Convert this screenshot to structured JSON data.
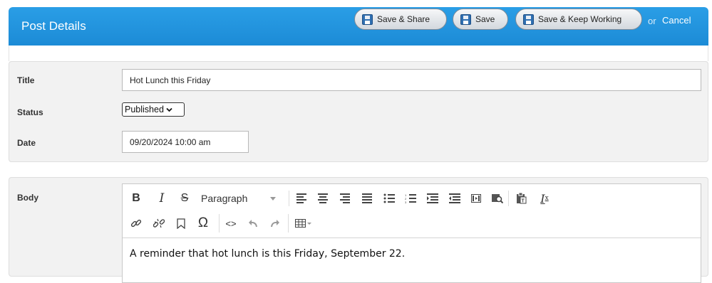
{
  "header": {
    "title": "Post Details",
    "save_share_label": "Save & Share",
    "save_label": "Save",
    "save_keep_label": "Save & Keep Working",
    "or_text": "or",
    "cancel_label": "Cancel",
    "accent_color": "#1f93dd"
  },
  "fields": {
    "title_label": "Title",
    "title_value": "Hot Lunch this Friday",
    "status_label": "Status",
    "status_value": "Published",
    "date_label": "Date",
    "date_value": "09/20/2024 10:00 am",
    "body_label": "Body"
  },
  "editor": {
    "format_select": "Paragraph",
    "toolbar_row1": [
      "bold-icon",
      "italic-icon",
      "strikethrough-icon",
      "format-select",
      "align-left-icon",
      "align-center-icon",
      "align-right-icon",
      "align-justify-icon",
      "bullet-list-icon",
      "numbered-list-icon",
      "indent-icon",
      "outdent-icon",
      "media-icon",
      "find-replace-icon",
      "paste-text-icon",
      "clear-format-icon"
    ],
    "toolbar_row2": [
      "link-icon",
      "unlink-icon",
      "bookmark-icon",
      "special-char-icon",
      "code-icon",
      "undo-icon",
      "redo-icon",
      "table-icon"
    ],
    "content": "A reminder that hot lunch is this Friday, September 22."
  }
}
